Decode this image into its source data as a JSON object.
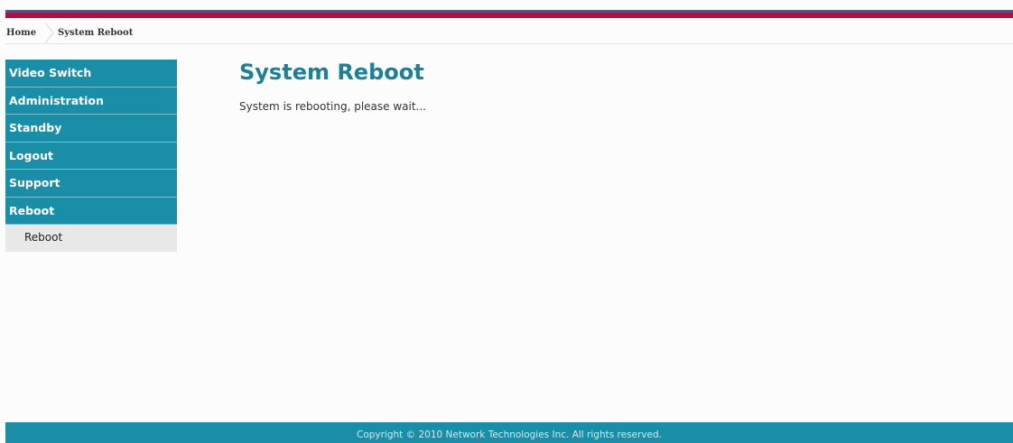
{
  "breadcrumb": {
    "home": "Home",
    "current": "System Reboot"
  },
  "sidebar": {
    "items": [
      {
        "label": "Video Switch"
      },
      {
        "label": "Administration"
      },
      {
        "label": "Standby"
      },
      {
        "label": "Logout"
      },
      {
        "label": "Support"
      },
      {
        "label": "Reboot"
      }
    ],
    "sub_items": [
      {
        "label": "Reboot"
      }
    ]
  },
  "main": {
    "title": "System Reboot",
    "message": "System is rebooting, please wait..."
  },
  "footer": {
    "copyright": "Copyright © 2010 Network Technologies Inc. All rights reserved."
  },
  "colors": {
    "accent": "#1a8ea6",
    "title": "#1c8097",
    "stripe_red": "#a8123e",
    "stripe_blue": "#3d5aa8"
  }
}
